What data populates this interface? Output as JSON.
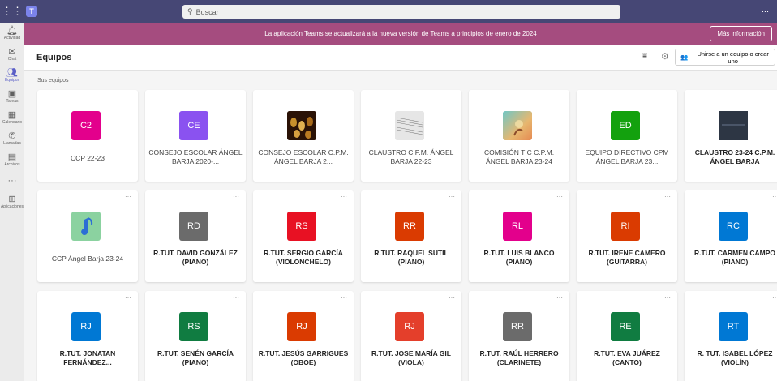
{
  "topbar": {
    "search_placeholder": "Buscar",
    "more_label": "..."
  },
  "banner": {
    "message": "La aplicación Teams se actualizará a la nueva versión de Teams a principios de enero de 2024",
    "button": "Más información"
  },
  "rail": [
    {
      "label": "Actividad",
      "icon": "bell-icon"
    },
    {
      "label": "Chat",
      "icon": "chat-icon"
    },
    {
      "label": "Equipos",
      "icon": "teams-icon"
    },
    {
      "label": "Tareas",
      "icon": "backpack-icon"
    },
    {
      "label": "Calendario",
      "icon": "calendar-icon"
    },
    {
      "label": "Llamadas",
      "icon": "phone-icon"
    },
    {
      "label": "Archivos",
      "icon": "file-icon"
    },
    {
      "label": "...",
      "icon": "more-icon"
    },
    {
      "label": "Aplicaciones",
      "icon": "apps-icon"
    }
  ],
  "header": {
    "title": "Equipos",
    "join_button": "Unirse a un equipo o crear uno"
  },
  "section_label": "Sus equipos",
  "card_more": "···",
  "teams": [
    {
      "initials": "C2",
      "color": "#e3008c",
      "name": "CCP 22-23",
      "bold": false
    },
    {
      "initials": "CE",
      "color": "#8a52f0",
      "name": "CONSEJO ESCOLAR ÁNGEL BARJA 2020-...",
      "bold": false
    },
    {
      "initials": "",
      "color": "",
      "name": "CONSEJO ESCOLAR C.P.M. ÁNGEL BARJA 2...",
      "bold": false,
      "image": "guitars"
    },
    {
      "initials": "",
      "color": "",
      "name": "CLAUSTRO C.P.M. ÁNGEL BARJA 22-23",
      "bold": false,
      "image": "sheet"
    },
    {
      "initials": "",
      "color": "",
      "name": "COMISIÓN TIC C.P.M. ÁNGEL BARJA 23-24",
      "bold": false,
      "image": "teal"
    },
    {
      "initials": "ED",
      "color": "#13a10e",
      "name": "EQUIPO DIRECTIVO CPM ÁNGEL BARJA 23...",
      "bold": false
    },
    {
      "initials": "",
      "color": "",
      "name": "CLAUSTRO 23-24 C.P.M. ÁNGEL BARJA",
      "bold": true,
      "image": "dark"
    },
    {
      "initials": "",
      "color": "",
      "name": "CCP Ángel Barja 23-24",
      "bold": false,
      "image": "note"
    },
    {
      "initials": "RD",
      "color": "#6b6b6b",
      "name": "R.TUT. DAVID GONZÁLEZ (PIANO)",
      "bold": true
    },
    {
      "initials": "RS",
      "color": "#e81123",
      "name": "R.TUT. SERGIO GARCÍA (VIOLONCHELO)",
      "bold": true
    },
    {
      "initials": "RR",
      "color": "#da3b01",
      "name": "R.TUT. RAQUEL SUTIL (PIANO)",
      "bold": true
    },
    {
      "initials": "RL",
      "color": "#e3008c",
      "name": "R.TUT. LUIS BLANCO (PIANO)",
      "bold": true
    },
    {
      "initials": "RI",
      "color": "#da3b01",
      "name": "R.TUT. IRENE CAMERO (GUITARRA)",
      "bold": true
    },
    {
      "initials": "RC",
      "color": "#0078d4",
      "name": "R.TUT. CARMEN CAMPO (PIANO)",
      "bold": true
    },
    {
      "initials": "RJ",
      "color": "#0078d4",
      "name": "R.TUT. JONATAN FERNÁNDEZ...",
      "bold": true
    },
    {
      "initials": "RS",
      "color": "#107c41",
      "name": "R.TUT. SENÉN GARCÍA (PIANO)",
      "bold": true
    },
    {
      "initials": "RJ",
      "color": "#da3b01",
      "name": "R.TUT. JESÚS GARRIGUES (OBOE)",
      "bold": true
    },
    {
      "initials": "RJ",
      "color": "#e43f2b",
      "name": "R.TUT. JOSE MARÍA GIL (VIOLA)",
      "bold": true
    },
    {
      "initials": "RR",
      "color": "#6b6b6b",
      "name": "R.TUT. RAÚL HERRERO (CLARINETE)",
      "bold": true
    },
    {
      "initials": "RE",
      "color": "#107c41",
      "name": "R.TUT. EVA JUÁREZ (CANTO)",
      "bold": true
    },
    {
      "initials": "RT",
      "color": "#0078d4",
      "name": "R. TUT. ISABEL LÓPEZ (VIOLÍN)",
      "bold": true
    }
  ]
}
